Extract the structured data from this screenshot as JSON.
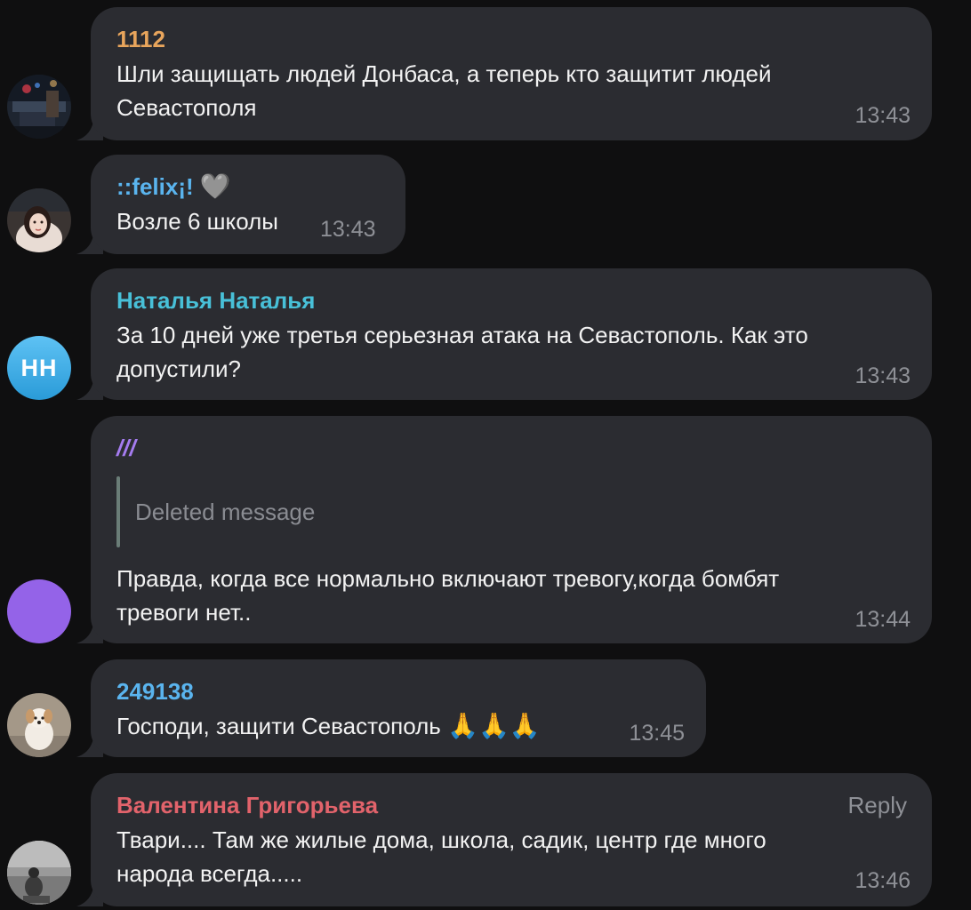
{
  "messages": [
    {
      "author": "1112",
      "author_color": "#e8a55c",
      "lines": [
        "Шли защищать людей Донбаса, а теперь кто защитит людей",
        "Севастополя"
      ],
      "time": "13:43"
    },
    {
      "author": "::felix¡!",
      "author_color": "#5ab4ee",
      "heart": "🩶",
      "lines": [
        "Возле 6 школы"
      ],
      "time": "13:43"
    },
    {
      "author": "Наталья Наталья",
      "author_color": "#48c0d8",
      "avatar_initials": "НН",
      "lines": [
        "За 10 дней уже третья серьезная атака на Севастополь. Как это",
        "допустили?"
      ],
      "time": "13:43"
    },
    {
      "author": "///",
      "author_color": "#a57cf0",
      "quoted": "Deleted message",
      "lines": [
        "Правда, когда все нормально включают тревогу,когда бомбят",
        "тревоги нет.."
      ],
      "time": "13:44"
    },
    {
      "author": "249138",
      "author_color": "#5ab4ee",
      "lines": [
        "Господи, защити Севастополь"
      ],
      "emoji": "🙏🙏🙏",
      "time": "13:45"
    },
    {
      "author": "Валентина Григорьева",
      "author_color": "#e2636b",
      "reply_label": "Reply",
      "lines": [
        "Твари.... Там же жилые дома, школа, садик, центр где много",
        "народа всегда....."
      ],
      "time": "13:46"
    }
  ],
  "colors": {
    "background": "#0f0f10",
    "bubble": "#2b2c31",
    "text": "#f2f2f2",
    "meta": "#8e9096",
    "quote_bar": "#6a7d77",
    "avatar_purple": "#9463e8"
  },
  "icons": [
    "heart-icon",
    "praying-hands-icon",
    "bubble-tail"
  ]
}
